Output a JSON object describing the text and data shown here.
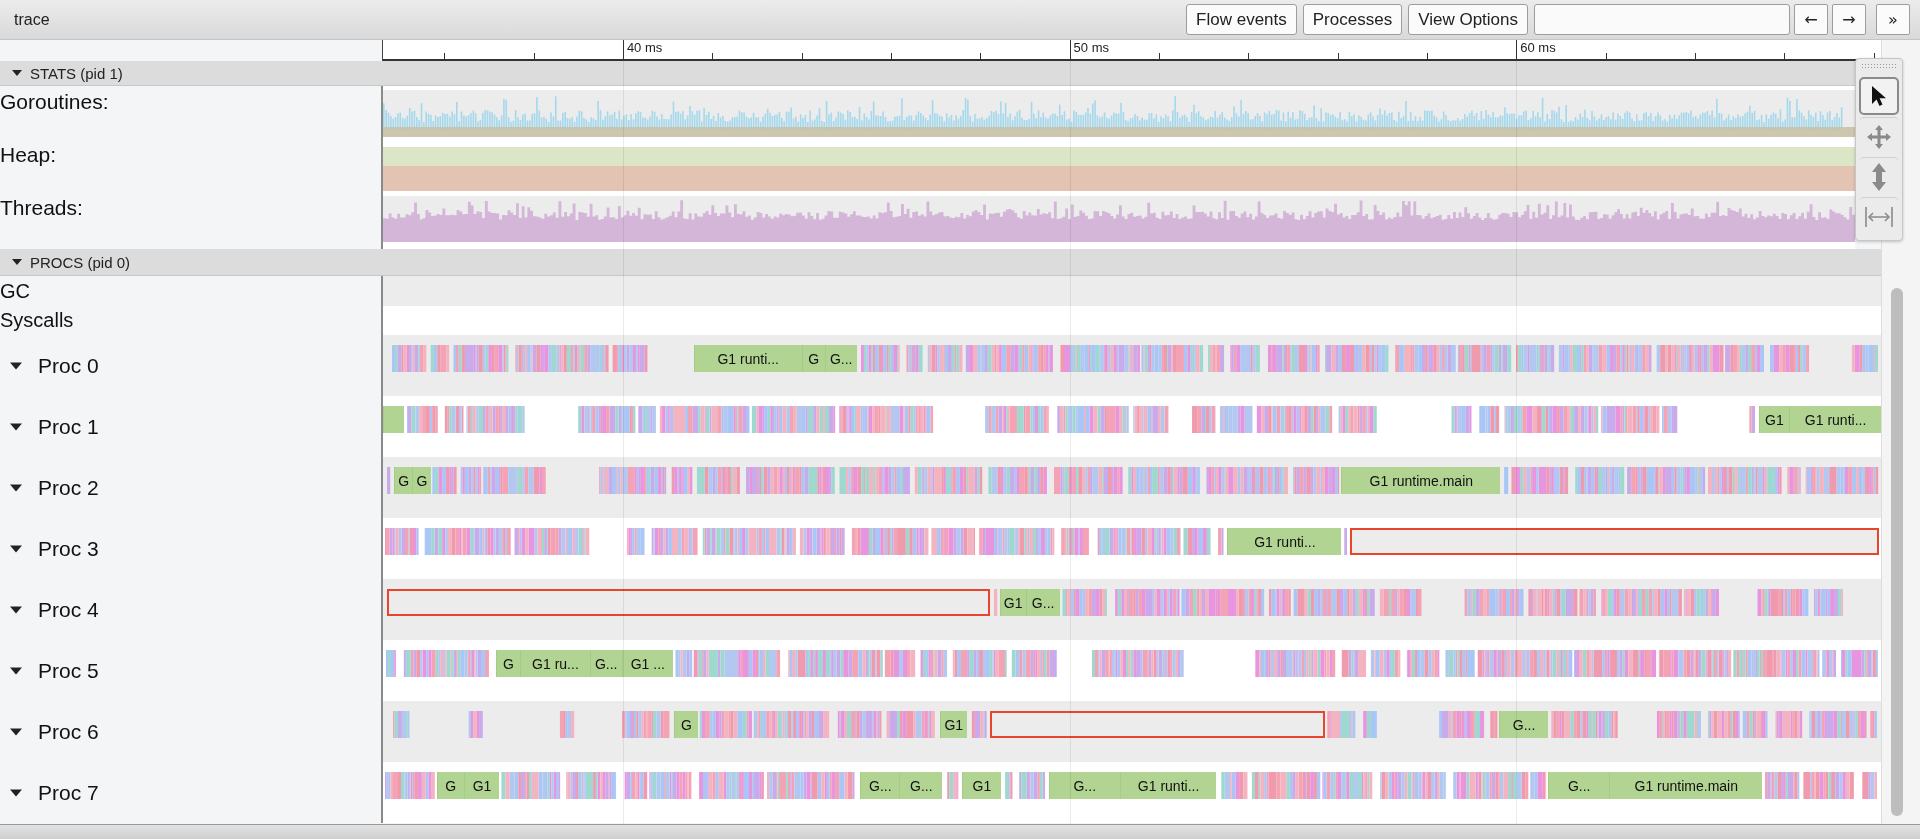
{
  "window": {
    "title": "trace"
  },
  "toolbar": {
    "buttons": [
      "Flow events",
      "Processes",
      "View Options"
    ],
    "nav_buttons": [
      "←",
      "→",
      "»"
    ]
  },
  "ruler": {
    "labels": [
      "40 ms",
      "50 ms",
      "60 ms"
    ]
  },
  "tools": [
    {
      "kind": "select",
      "selected": true
    },
    {
      "kind": "pan",
      "selected": false
    },
    {
      "kind": "zoom",
      "selected": false
    },
    {
      "kind": "timing",
      "selected": false
    }
  ],
  "sections": [
    {
      "title": "STATS (pid 1)",
      "expanded": true,
      "tracks": [
        {
          "label": "Goroutines:",
          "kind": "goroutines"
        },
        {
          "label": "Heap:",
          "kind": "heap"
        },
        {
          "label": "Threads:",
          "kind": "threads"
        }
      ]
    },
    {
      "title": "PROCS (pid 0)",
      "expanded": true,
      "tracks": [
        {
          "label": "GC",
          "kind": "plain"
        },
        {
          "label": "Syscalls",
          "kind": "plain"
        },
        {
          "label": "Proc 0",
          "kind": "proc",
          "expanded": true,
          "slices": [
            {
              "label": "G1 runti...",
              "selected": false
            },
            {
              "label": "G",
              "selected": false
            },
            {
              "label": "G...",
              "selected": false
            }
          ]
        },
        {
          "label": "Proc 1",
          "kind": "proc",
          "expanded": true,
          "slices": [
            {
              "selected": false
            },
            {
              "label": "G1",
              "selected": false
            },
            {
              "label": "G1 runti...",
              "selected": false
            }
          ]
        },
        {
          "label": "Proc 2",
          "kind": "proc",
          "expanded": true,
          "slices": [
            {
              "label": "G",
              "selected": false
            },
            {
              "label": "G",
              "selected": false
            },
            {
              "label": "G1 runtime.main",
              "selected": false
            }
          ]
        },
        {
          "label": "Proc 3",
          "kind": "proc",
          "expanded": true,
          "slices": [
            {
              "label": "G1 runti...",
              "selected": false
            },
            {
              "selected": true
            }
          ]
        },
        {
          "label": "Proc 4",
          "kind": "proc",
          "expanded": true,
          "slices": [
            {
              "selected": true
            },
            {
              "label": "G1",
              "selected": false
            },
            {
              "label": "G...",
              "selected": false
            }
          ]
        },
        {
          "label": "Proc 5",
          "kind": "proc",
          "expanded": true,
          "slices": [
            {
              "label": "G",
              "selected": false
            },
            {
              "label": "G1 ru...",
              "selected": false
            },
            {
              "label": "G...",
              "selected": false
            },
            {
              "label": "G1 ...",
              "selected": false
            }
          ]
        },
        {
          "label": "Proc 6",
          "kind": "proc",
          "expanded": true,
          "slices": [
            {
              "label": "G",
              "selected": false
            },
            {
              "label": "G1",
              "selected": false
            },
            {
              "selected": true
            },
            {
              "label": "G...",
              "selected": false
            }
          ]
        },
        {
          "label": "Proc 7",
          "kind": "proc",
          "expanded": true,
          "slices": [
            {
              "label": "G",
              "selected": false
            },
            {
              "label": "G1",
              "selected": false
            },
            {
              "label": "G...",
              "selected": false
            },
            {
              "label": "G...",
              "selected": false
            },
            {
              "label": "G1",
              "selected": false
            },
            {
              "label": "G...",
              "selected": false
            },
            {
              "label": "G1 runti...",
              "selected": false
            },
            {
              "label": "G...",
              "selected": false
            },
            {
              "label": "G1 runtime.main",
              "selected": false
            }
          ]
        }
      ]
    }
  ]
}
